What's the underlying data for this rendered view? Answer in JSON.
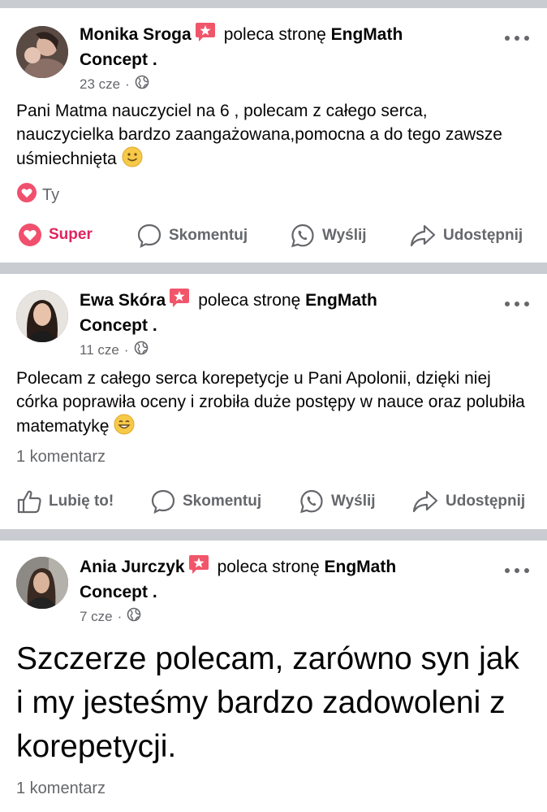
{
  "posts": [
    {
      "author": "Monika Sroga",
      "verb": "poleca stronę",
      "page_name": "EngMath",
      "page_name_line2": "Concept .",
      "time": "23 cze",
      "text": "Pani Matma nauczyciel na 6 , polecam z całego serca, nauczycielka bardzo zaangażowana,pomocna a do tego zawsze uśmiechnięta",
      "reaction_by": "Ty",
      "actions": {
        "like": "Super",
        "comment": "Skomentuj",
        "send": "Wyślij",
        "share": "Udostępnij"
      }
    },
    {
      "author": "Ewa Skóra",
      "verb": "poleca stronę",
      "page_name": "EngMath",
      "page_name_line2": "Concept .",
      "time": "11 cze",
      "text": "Polecam z całego serca korepetycje u Pani Apolonii, dzięki niej córka poprawiła oceny i zrobiła duże postępy w nauce oraz polubiła matematykę",
      "comments": "1 komentarz",
      "actions": {
        "like": "Lubię to!",
        "comment": "Skomentuj",
        "send": "Wyślij",
        "share": "Udostępnij"
      }
    },
    {
      "author": "Ania Jurczyk",
      "verb": "poleca stronę",
      "page_name": "EngMath",
      "page_name_line2": "Concept .",
      "time": "7 cze",
      "text": "Szczerze polecam, zarówno syn jak i my jesteśmy bardzo zadowoleni z korepetycji.",
      "comments": "1 komentarz"
    }
  ],
  "colors": {
    "accent_red": "#e0245e",
    "muted": "#65676b",
    "divider": "#c9ccd1"
  }
}
